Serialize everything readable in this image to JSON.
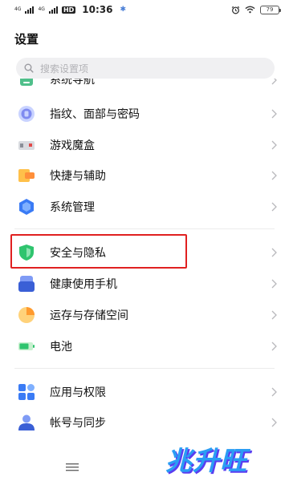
{
  "status_bar": {
    "signal_1": "4G",
    "signal_2": "4G",
    "hd": "HD",
    "time": "10:36",
    "battery": "79"
  },
  "page": {
    "title": "设置"
  },
  "search": {
    "placeholder": "搜索设置项"
  },
  "items": [
    {
      "label": "系统导航",
      "icon": "navigation-icon"
    },
    {
      "label": "指纹、面部与密码",
      "icon": "fingerprint-icon"
    },
    {
      "label": "游戏魔盒",
      "icon": "game-box-icon"
    },
    {
      "label": "快捷与辅助",
      "icon": "shortcut-icon"
    },
    {
      "label": "系统管理",
      "icon": "system-management-icon"
    },
    {
      "label": "安全与隐私",
      "icon": "shield-icon"
    },
    {
      "label": "健康使用手机",
      "icon": "health-icon"
    },
    {
      "label": "运存与存储空间",
      "icon": "storage-icon"
    },
    {
      "label": "电池",
      "icon": "battery-icon"
    },
    {
      "label": "应用与权限",
      "icon": "apps-icon"
    },
    {
      "label": "帐号与同步",
      "icon": "account-icon"
    }
  ],
  "watermark": "兆升旺",
  "colors": {
    "highlight_border": "#e02020",
    "search_bg": "#f0f0f2",
    "shield_green": "#2fc46e",
    "accent_blue": "#3a7bf5"
  }
}
